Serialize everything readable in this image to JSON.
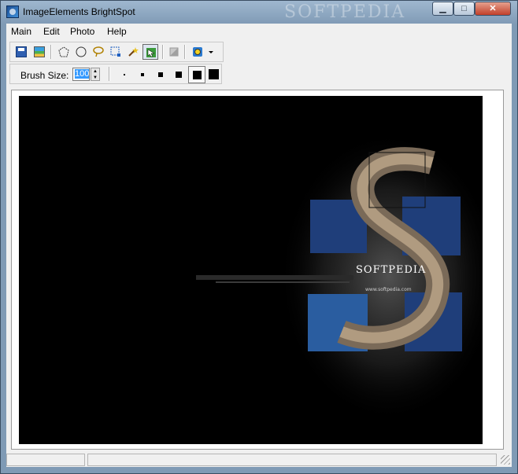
{
  "window": {
    "title": "ImageElements BrightSpot",
    "watermark": "SOFTPEDIA"
  },
  "title_buttons": {
    "minimize": "▁",
    "maximize": "□",
    "close": "✕"
  },
  "menu": {
    "items": [
      "Main",
      "Edit",
      "Photo",
      "Help"
    ]
  },
  "toolbar": {
    "icons": [
      "save-icon",
      "open-image-icon",
      "polygon-select-icon",
      "ellipse-select-icon",
      "lasso-select-icon",
      "rect-select-icon",
      "magic-wand-icon",
      "brush-select-icon",
      "eraser-icon",
      "filter-icon",
      "dropdown-arrow-icon"
    ]
  },
  "brush": {
    "label": "Brush Size:",
    "value": "100",
    "spin_up": "▲",
    "spin_down": "▼"
  },
  "image": {
    "brand": "SOFTPEDIA",
    "url": "www.softpedia.com"
  },
  "status": {
    "pane1": "",
    "pane2": ""
  },
  "colors": {
    "accent": "#3399ff",
    "title_gradient": "#9fb7cf",
    "canvas": "#000000"
  }
}
